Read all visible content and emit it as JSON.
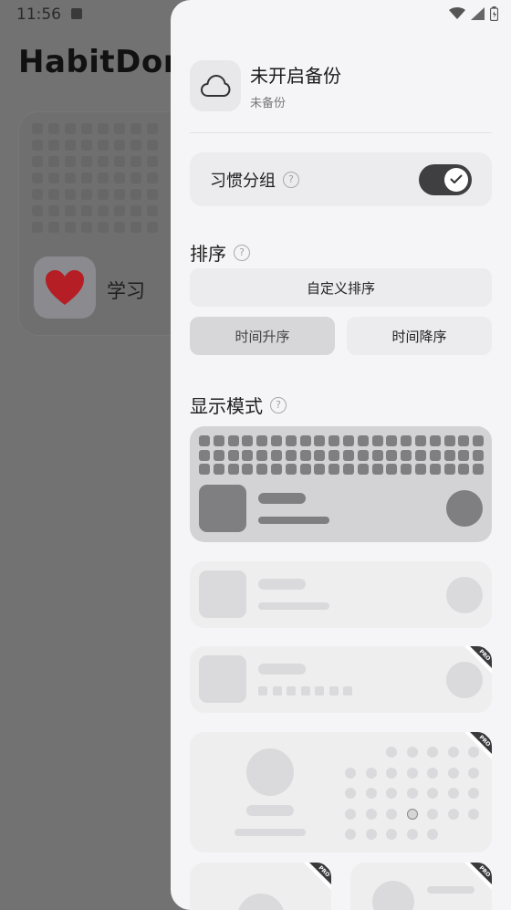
{
  "status": {
    "time": "11:56"
  },
  "app": {
    "title": "HabitDone",
    "habit_name": "学习"
  },
  "drawer": {
    "backup_title": "未开启备份",
    "backup_subtitle": "未备份",
    "group_label": "习惯分组",
    "group_toggle_on": true,
    "sort_title": "排序",
    "sort_custom": "自定义排序",
    "sort_time_asc": "时间升序",
    "sort_time_desc": "时间降序",
    "sort_selected": "时间升序",
    "display_title": "显示模式",
    "help_glyph": "?",
    "pro_badge": "PRO",
    "display_modes": [
      {
        "id": "grid-list",
        "selected": true
      },
      {
        "id": "compact-list",
        "selected": false
      },
      {
        "id": "week-list",
        "selected": false,
        "pro": true
      },
      {
        "id": "calendar-card",
        "selected": false,
        "pro": true
      },
      {
        "id": "tile-a",
        "selected": false,
        "pro": true
      },
      {
        "id": "tile-b",
        "selected": false,
        "pro": true
      }
    ]
  },
  "colors": {
    "scrim": "#727273",
    "drawer_bg": "#f5f5f7",
    "card_bg": "#ececee",
    "selected_card": "#d3d3d5",
    "toggle_on": "#3f3f41",
    "heart": "#b51e24"
  }
}
